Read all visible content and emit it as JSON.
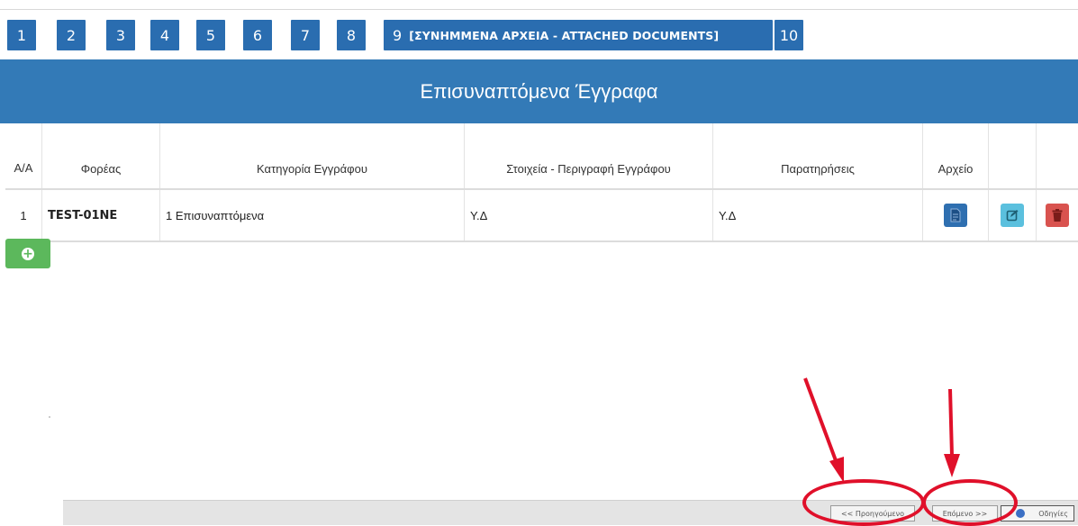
{
  "steps": [
    "1",
    "2",
    "3",
    "4",
    "5",
    "6",
    "7",
    "8"
  ],
  "active_step": {
    "number": "9",
    "label": "[ΣΥΝΗΜΜΕΝΑ ΑΡΧΕΙΑ - ATTACHED DOCUMENTS]"
  },
  "next_step": "10",
  "banner_title": "Επισυναπτόμενα Έγγραφα",
  "table": {
    "headers": [
      "Α/Α",
      "Φορέας",
      "Κατηγορία Εγγράφου",
      "Στοιχεία - Περιγραφή Εγγράφου",
      "Παρατηρήσεις",
      "Αρχείο",
      "",
      ""
    ],
    "rows": [
      {
        "aa": "1",
        "foreas": "TEST-01NE",
        "category": "1 Επισυναπτόμενα",
        "description": "Υ.Δ",
        "notes": "Υ.Δ"
      }
    ]
  },
  "icons": {
    "file": "document-icon",
    "edit": "edit-icon",
    "delete": "trash-icon",
    "add": "plus-circle-icon",
    "help": "help-icon"
  },
  "footer": {
    "previous": "<< Προηγούμενο",
    "next": "Επόμενο >>",
    "help": "Οδηγίες"
  },
  "colors": {
    "primary": "#337ab7",
    "step": "#2a6db0",
    "success": "#5cb85c",
    "info": "#5bc0de",
    "danger": "#d9534f",
    "annotation": "#e0102a"
  }
}
